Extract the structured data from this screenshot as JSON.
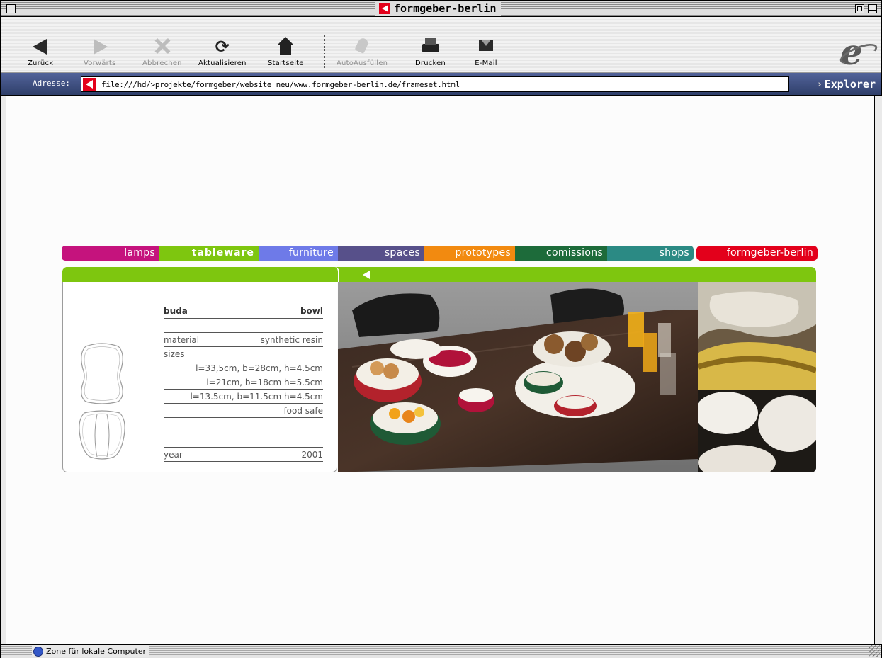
{
  "window": {
    "title": "formgeber-berlin"
  },
  "toolbar": {
    "buttons": [
      {
        "label": "Zurück",
        "icon": "back-arrow-icon",
        "enabled": true
      },
      {
        "label": "Vorwärts",
        "icon": "forward-arrow-icon",
        "enabled": false
      },
      {
        "label": "Abbrechen",
        "icon": "stop-icon",
        "enabled": false
      },
      {
        "label": "Aktualisieren",
        "icon": "refresh-icon",
        "enabled": true
      },
      {
        "label": "Startseite",
        "icon": "home-icon",
        "enabled": true
      },
      {
        "label": "AutoAusfüllen",
        "icon": "autofill-icon",
        "enabled": false
      },
      {
        "label": "Drucken",
        "icon": "print-icon",
        "enabled": true
      },
      {
        "label": "E-Mail",
        "icon": "mail-icon",
        "enabled": true
      }
    ]
  },
  "address": {
    "label": "Adresse:",
    "url": "file:///hd/>projekte/formgeber/website_neu/www.formgeber-berlin.de/frameset.html",
    "explorer_label": "Explorer"
  },
  "nav": {
    "items": [
      {
        "label": "lamps",
        "color": "#c5137d"
      },
      {
        "label": "tableware",
        "color": "#7ec60f",
        "active": true
      },
      {
        "label": "furniture",
        "color": "#6e7ae8"
      },
      {
        "label": "spaces",
        "color": "#57508a"
      },
      {
        "label": "prototypes",
        "color": "#f28a10"
      },
      {
        "label": "comissions",
        "color": "#1d6b3a"
      },
      {
        "label": "shops",
        "color": "#2b8a84"
      },
      {
        "label": "formgeber-berlin",
        "color": "#e3001b"
      }
    ]
  },
  "product": {
    "name": "buda",
    "type": "bowl",
    "material_label": "material",
    "material": "synthetic resin",
    "sizes_label": "sizes",
    "sizes": [
      "l=33,5cm, b=28cm, h=4.5cm",
      "l=21cm, b=18cm h=5.5cm",
      "l=13.5cm, b=11.5cm h=4.5cm"
    ],
    "note": "food safe",
    "year_label": "year",
    "year": "2001"
  },
  "status": {
    "text": "Zone für lokale Computer"
  },
  "colors": {
    "accent_green": "#7ec60f",
    "brand_red": "#e3001b",
    "address_bar": "#3d4e7a"
  }
}
